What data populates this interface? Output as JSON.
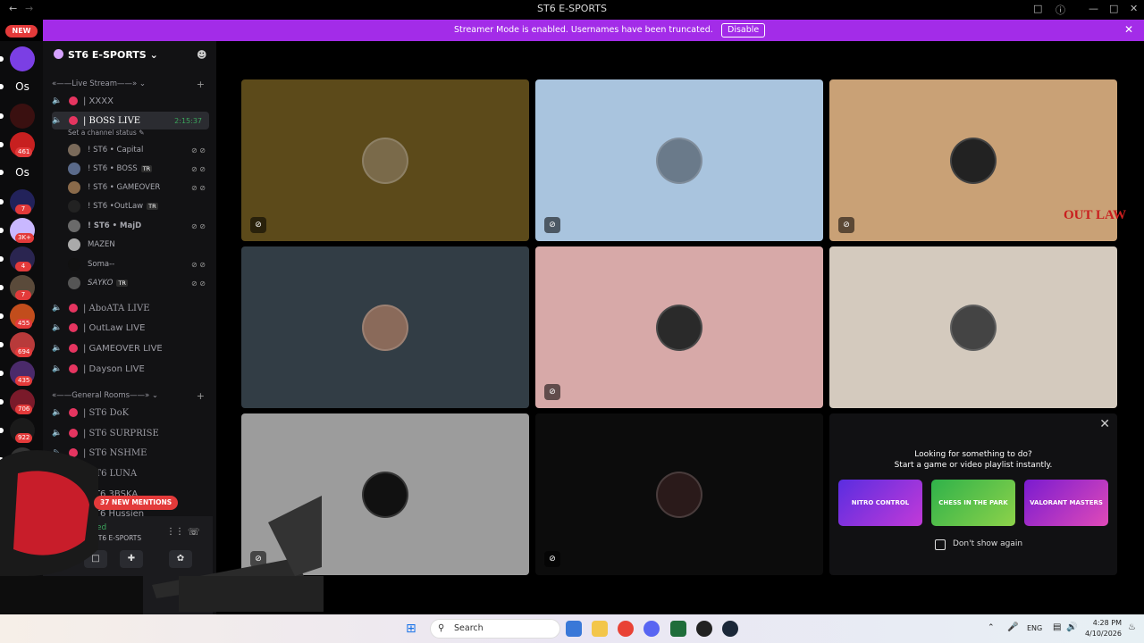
{
  "window": {
    "title": "ST6 E-SPORTS"
  },
  "banner": {
    "text": "Streamer Mode is enabled. Usernames have been truncated.",
    "button": "Disable"
  },
  "servers": {
    "new_label": "NEW",
    "items": [
      {
        "name": "purple-server-icon",
        "badge": "",
        "color": "#7b3fe4"
      },
      {
        "name": "Os",
        "badge": "",
        "color": "#1e1f22"
      },
      {
        "name": "red-crest-server-icon",
        "badge": "",
        "color": "#3a1010"
      },
      {
        "name": "mario-server-icon",
        "badge": "461",
        "color": "#c72020"
      },
      {
        "name": "Os",
        "badge": "",
        "color": "#1e1f22"
      },
      {
        "name": "dark-server-icon",
        "badge": "7",
        "color": "#22225a"
      },
      {
        "name": "st-server-icon",
        "badge": "3K+",
        "color": "#c9b8ff"
      },
      {
        "name": "wings-server-icon",
        "badge": "4",
        "color": "#2a2550"
      },
      {
        "name": "portrait-server-icon",
        "badge": "7",
        "color": "#5a4a3a"
      },
      {
        "name": "fire-server-icon",
        "badge": "455",
        "color": "#c24d1c"
      },
      {
        "name": "bear-server-icon",
        "badge": "694",
        "color": "#b83a3a"
      },
      {
        "name": "mirror-server-icon",
        "badge": "435",
        "color": "#4a2a6a"
      },
      {
        "name": "shield-server-icon",
        "badge": "706",
        "color": "#7a1a2a"
      },
      {
        "name": "st-server-icon",
        "badge": "922",
        "color": "#1a1a1a"
      },
      {
        "name": "clan-server-icon",
        "badge": "",
        "color": "#333"
      }
    ]
  },
  "guild": {
    "name": "ST6 E-SPORTS"
  },
  "categories": {
    "live": "«——Live Stream——»",
    "general": "«——General Rooms——»"
  },
  "live_channels": [
    {
      "label": "| XXXX"
    },
    {
      "label": "| BOSS LIVE",
      "timer": "2:15:37",
      "status": "Set a channel status"
    },
    {
      "label": "| AboATA LIVE"
    },
    {
      "label": "| OutLaw LIVE"
    },
    {
      "label": "| GAMEOVER LIVE"
    },
    {
      "label": "| Dayson LIVE"
    }
  ],
  "voice_users": [
    {
      "name": "! ST6 • Capital",
      "tag": ""
    },
    {
      "name": "! ST6 • BOSS",
      "tag": "TR"
    },
    {
      "name": "! ST6 • GAMEOVER",
      "tag": ""
    },
    {
      "name": "! ST6 •OutLaw",
      "tag": "TR"
    },
    {
      "name": "! ST6 • MajD",
      "tag": ""
    },
    {
      "name": "MAZEN",
      "tag": ""
    },
    {
      "name": "Soma--",
      "tag": ""
    },
    {
      "name": "SAYKO",
      "tag": "TR"
    }
  ],
  "general_channels": [
    {
      "label": "| ST6 DoK"
    },
    {
      "label": "| ST6 SURPRISE"
    },
    {
      "label": "| ST6 NSHME"
    },
    {
      "label": "| ST6 LUNA"
    },
    {
      "label": "| ST6 3BSKA"
    },
    {
      "label": "| ST6 Hussien"
    }
  ],
  "mentions": {
    "label": "37 NEW MENTIONS"
  },
  "voice_panel": {
    "status": "ed",
    "server": "ST6 E-SPORTS"
  },
  "tiles": [
    {
      "bg": "#5c4a1a",
      "avatar": "#7a6a4a",
      "muted": true
    },
    {
      "bg": "#a9c4de",
      "avatar": "#6a7a8a",
      "muted": true
    },
    {
      "bg": "#c9a176",
      "avatar": "#222",
      "muted": true
    },
    {
      "bg": "#323d45",
      "avatar": "#8a6a5a",
      "muted": false
    },
    {
      "bg": "#d7a9a8",
      "avatar": "#2a2a2a",
      "muted": true
    },
    {
      "bg": "#d4cabe",
      "avatar": "#444",
      "muted": false
    },
    {
      "bg": "#9c9c9c",
      "avatar": "#111",
      "muted": true
    },
    {
      "bg": "#0c0c0c",
      "avatar": "#2a1a1a",
      "muted": true
    }
  ],
  "activity": {
    "title": "Looking for something to do?",
    "subtitle": "Start a game or video playlist instantly.",
    "cards": [
      "NITRO CONTROL",
      "CHESS IN THE PARK",
      "VALORANT MASTERS"
    ],
    "checkbox": "Don't show again"
  },
  "overlay": {
    "logo": "OUT LAW"
  },
  "taskbar": {
    "search": "Search",
    "lang": "ENG",
    "time": "4:28 PM",
    "date": "4/10/2026"
  }
}
